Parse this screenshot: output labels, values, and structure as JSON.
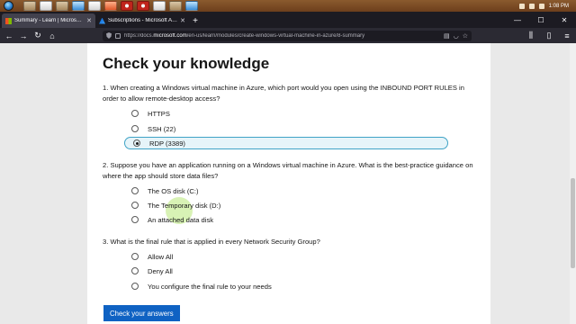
{
  "taskbar": {
    "clock_time": "1:08 PM",
    "apps": [
      "explorer",
      "media",
      "orange-app",
      "firefox",
      "chrome",
      "opera",
      "notes",
      "files",
      "app",
      "app",
      "app"
    ]
  },
  "browser": {
    "tabs": [
      {
        "title": "Summary - Learn | Microsoft Do",
        "icon": "microsoft-icon",
        "active": true
      },
      {
        "title": "Subscriptions - Microsoft Azure",
        "icon": "azure-icon",
        "active": false
      }
    ],
    "url_prefix": "https://docs.",
    "url_domain": "microsoft.com",
    "url_path": "/en-us/learn/modules/create-windows-virtual-machine-in-azure/8-summary",
    "controls": {
      "minimize": "—",
      "maximize": "☐",
      "close": "✕"
    }
  },
  "quiz": {
    "title": "Check your knowledge",
    "questions": [
      {
        "text": "1. When creating a Windows virtual machine in Azure, which port would you open using the INBOUND PORT RULES in order to allow remote-desktop access?",
        "options": [
          "HTTPS",
          "SSH (22)",
          "RDP (3389)"
        ],
        "selected": 2
      },
      {
        "text": "2. Suppose you have an application running on a Windows virtual machine in Azure. What is the best-practice guidance on where the app should store data files?",
        "options": [
          "The OS disk (C:)",
          "The Temporary disk (D:)",
          "An attached data disk"
        ],
        "selected": null
      },
      {
        "text": "3. What is the final rule that is applied in every Network Security Group?",
        "options": [
          "Allow All",
          "Deny All",
          "You configure the final rule to your needs"
        ],
        "selected": null
      }
    ],
    "submit_label": "Check your answers"
  },
  "colors": {
    "accent": "#0f62c3",
    "selected_border": "#3fa3c6"
  }
}
